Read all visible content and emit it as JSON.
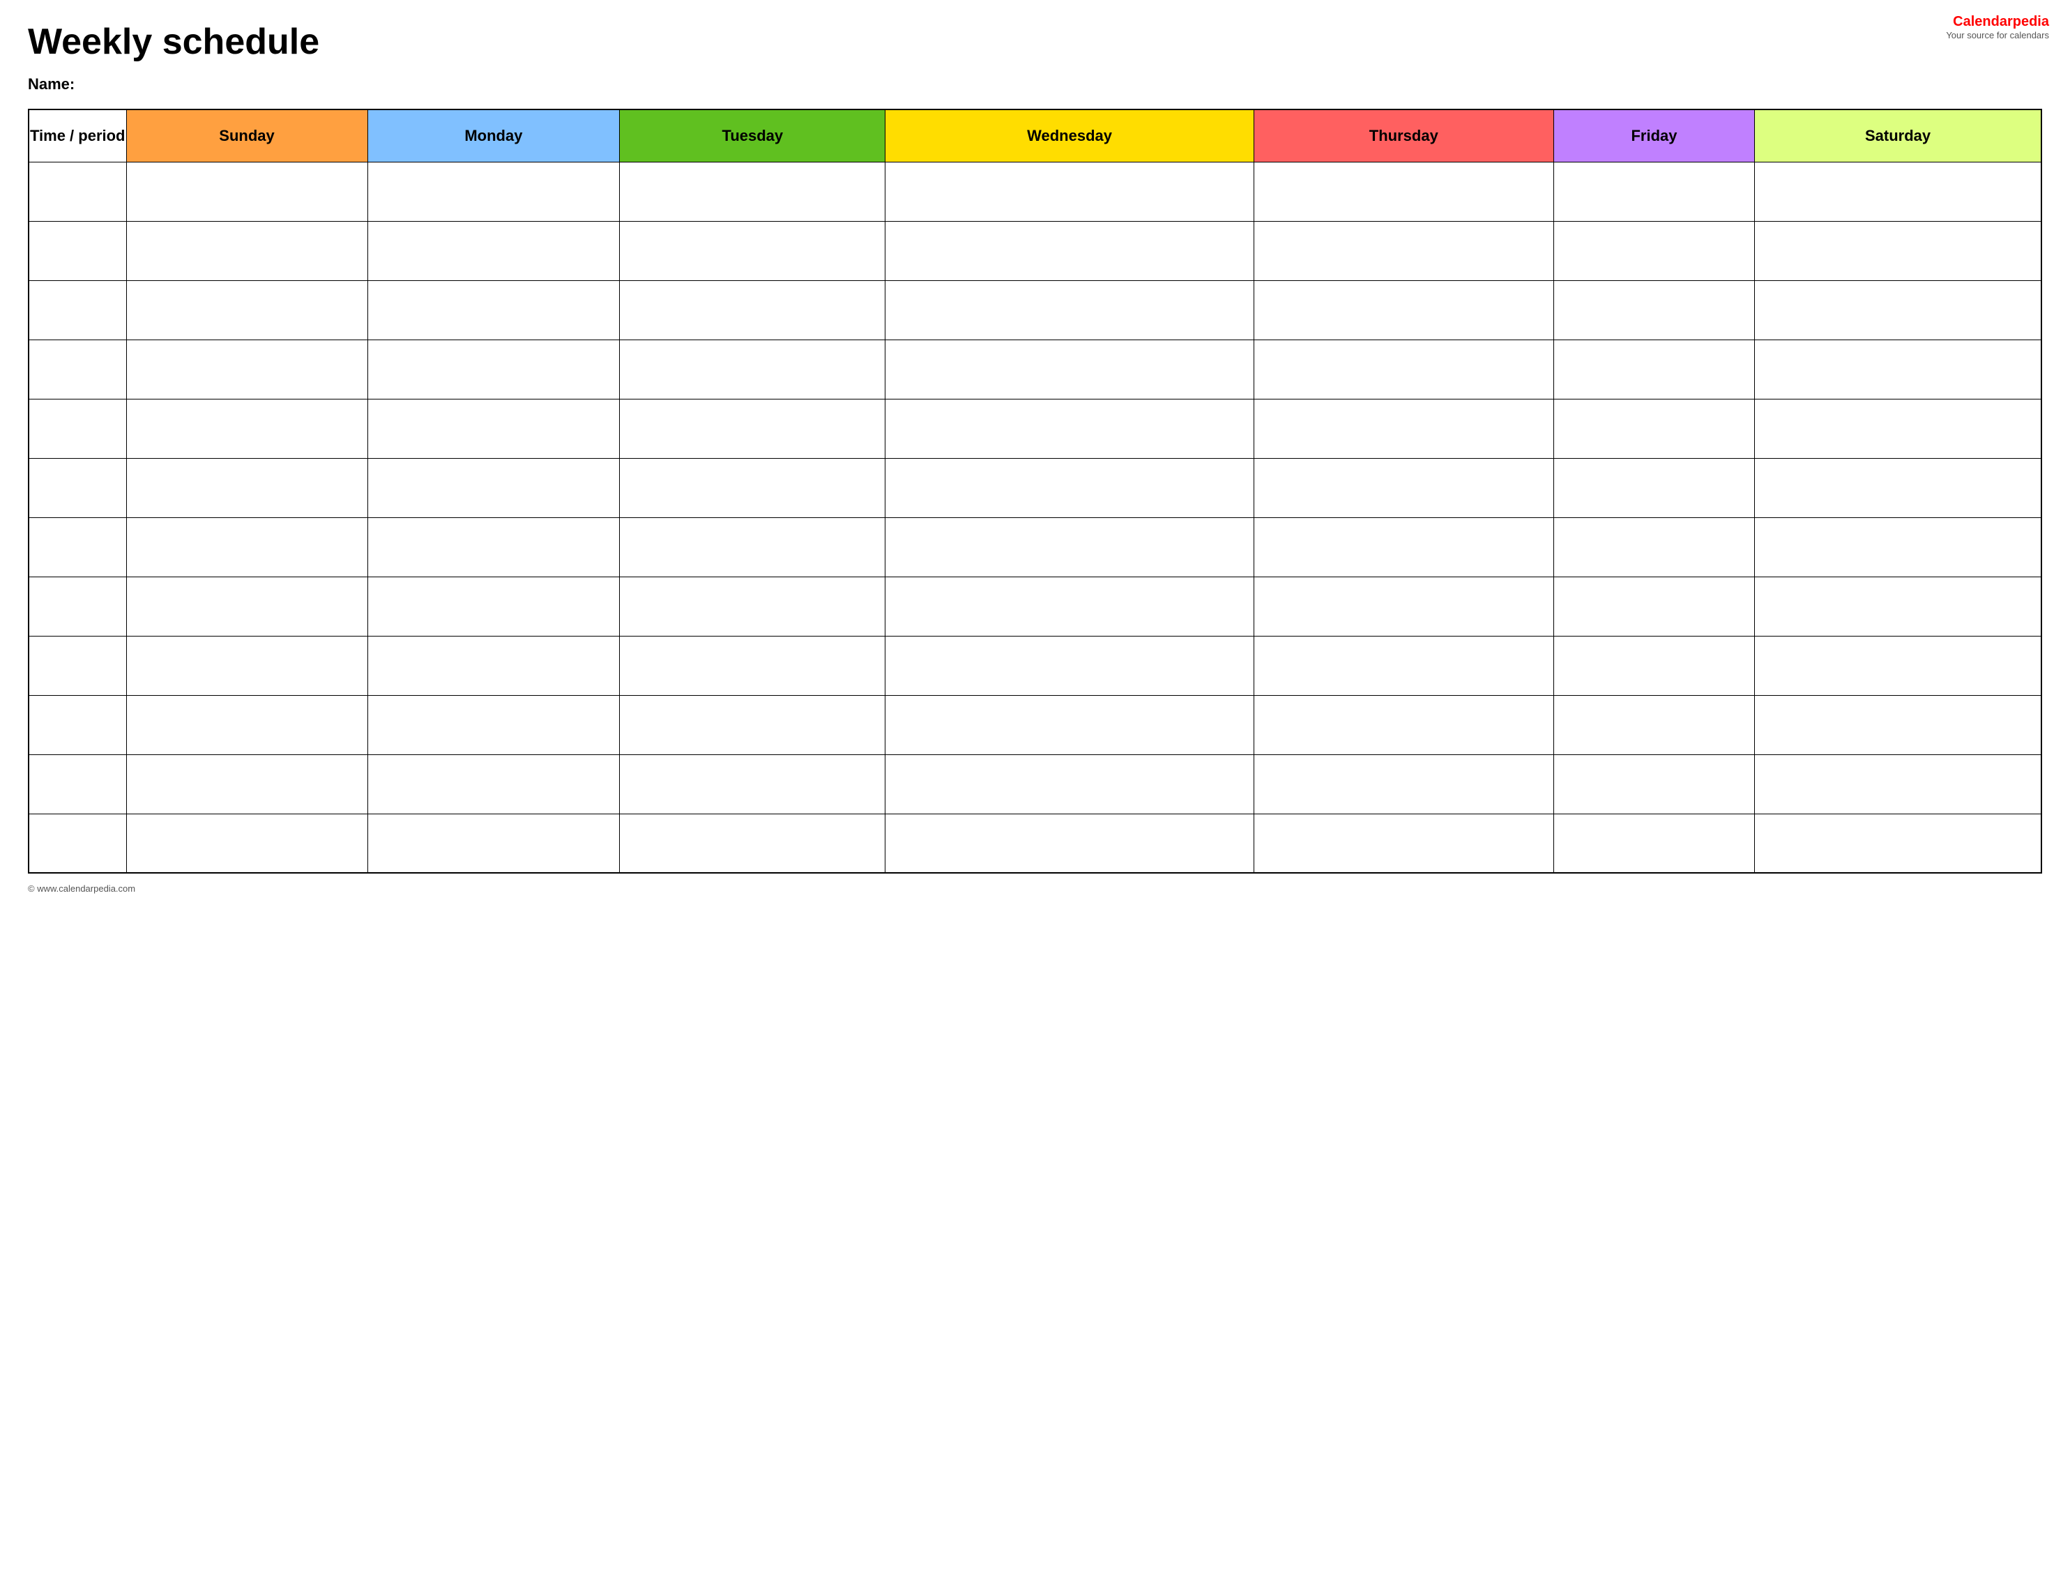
{
  "header": {
    "title": "Weekly schedule",
    "name_label": "Name:"
  },
  "logo": {
    "brand_part1": "Calendar",
    "brand_part2": "pedia",
    "tagline": "Your source for calendars"
  },
  "table": {
    "headers": [
      {
        "key": "time",
        "label": "Time / period",
        "color": "#ffffff"
      },
      {
        "key": "sunday",
        "label": "Sunday",
        "color": "#ffa040"
      },
      {
        "key": "monday",
        "label": "Monday",
        "color": "#80c0ff"
      },
      {
        "key": "tuesday",
        "label": "Tuesday",
        "color": "#60c020"
      },
      {
        "key": "wednesday",
        "label": "Wednesday",
        "color": "#ffdd00"
      },
      {
        "key": "thursday",
        "label": "Thursday",
        "color": "#ff6060"
      },
      {
        "key": "friday",
        "label": "Friday",
        "color": "#c080ff"
      },
      {
        "key": "saturday",
        "label": "Saturday",
        "color": "#ddff80"
      }
    ],
    "row_count": 12
  },
  "footer": {
    "url": "© www.calendarpedia.com"
  }
}
